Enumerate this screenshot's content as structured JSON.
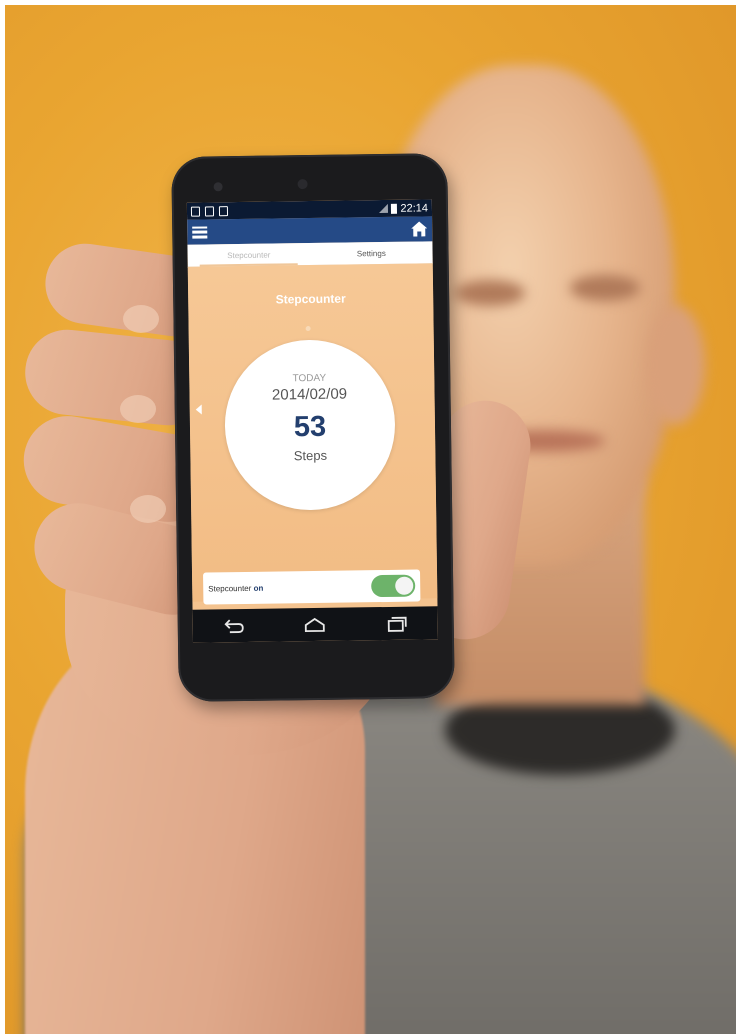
{
  "status_bar": {
    "time": "22:14"
  },
  "tabs": [
    {
      "label": "Stepcounter",
      "active": true
    },
    {
      "label": "Settings",
      "active": false
    }
  ],
  "main": {
    "title": "Stepcounter",
    "period_label": "TODAY",
    "date": "2014/02/09",
    "step_count": "53",
    "unit_label": "Steps"
  },
  "toggle_row": {
    "label": "Stepcounter",
    "state_label": "on",
    "enabled": true
  },
  "icons": [
    "menu-icon",
    "home-icon",
    "back-icon",
    "home-nav-icon",
    "recents-icon"
  ],
  "colors": {
    "app_bar": "#254a86",
    "status_bar": "#0b1a33",
    "screen_background": "#f4c38f",
    "toggle_on": "#6db36a",
    "step_count_text": "#233f6e"
  }
}
